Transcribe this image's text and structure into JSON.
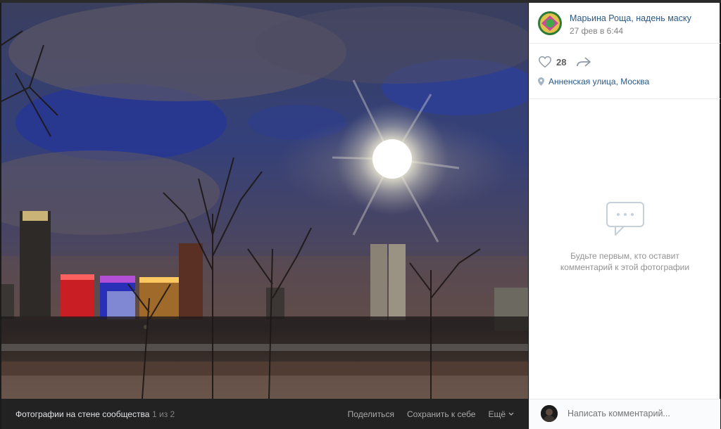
{
  "post": {
    "author": "Марьина Роща, надень маску",
    "date": "27 фев в 6:44",
    "likes": "28",
    "location": "Анненская улица, Москва"
  },
  "comments": {
    "empty_text": "Будьте первым, кто оставит комментарий к этой фотографии",
    "input_placeholder": "Написать комментарий..."
  },
  "bottom_bar": {
    "album_label": "Фотографии на стене сообщества",
    "counter": "1 из 2",
    "share": "Поделиться",
    "save": "Сохранить к себе",
    "more": "Ещё"
  },
  "icons": [
    "heart-icon",
    "share-icon",
    "location-pin-icon",
    "comment-bubble-icon",
    "chevron-down-icon"
  ],
  "colors": {
    "link": "#2a5885",
    "muted": "#939393",
    "viewer_bg": "#222222"
  }
}
